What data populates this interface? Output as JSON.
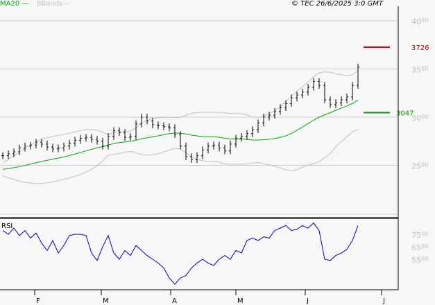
{
  "legend": {
    "ma": "MA20",
    "bbands": "BBands"
  },
  "copyright": "© TEC 26/6/2025 3:0 GMT",
  "colors": {
    "ma": "#00aa00",
    "bands": "#c0c0c0",
    "price": "#000000",
    "rsi": "#0000cc",
    "resistance": "#cc0000",
    "support": "#009900",
    "grid": "#cccccc",
    "axisText": "#c0c0c0"
  },
  "chart_data": [
    {
      "type": "line",
      "title": "Price (OHLC bars) with MA20 and Bollinger Bands",
      "ylim": [
        21,
        42.5
      ],
      "yticks": [
        {
          "value": 40,
          "label": "40",
          "sup": "00"
        },
        {
          "value": 35,
          "label": "35",
          "sup": "00"
        },
        {
          "value": 30,
          "label": "30",
          "sup": "00"
        },
        {
          "value": 25,
          "label": "25",
          "sup": "00"
        }
      ],
      "closes": [
        26.0,
        26.2,
        26.4,
        26.8,
        27.0,
        27.1,
        27.4,
        27.2,
        26.9,
        26.7,
        26.8,
        27.0,
        27.3,
        27.6,
        27.8,
        27.9,
        27.7,
        27.5,
        27.0,
        28.0,
        28.6,
        28.4,
        27.9,
        28.0,
        29.3,
        30.0,
        29.6,
        29.2,
        29.1,
        29.0,
        28.9,
        28.2,
        27.0,
        25.9,
        25.6,
        26.0,
        26.6,
        27.0,
        27.1,
        26.8,
        26.5,
        27.2,
        27.8,
        28.0,
        28.3,
        28.7,
        29.4,
        30.0,
        30.2,
        30.6,
        31.0,
        31.4,
        32.0,
        32.3,
        32.6,
        33.1,
        33.7,
        33.3,
        31.8,
        31.3,
        31.5,
        31.8,
        32.1,
        33.3,
        35.2
      ],
      "levels": [
        {
          "value": 37.26,
          "label": "3726",
          "kind": "resistance"
        },
        {
          "value": 30.47,
          "label": "3047",
          "kind": "support"
        }
      ],
      "xticks": [
        "F",
        "M",
        "A",
        "M",
        "J",
        "J"
      ]
    },
    {
      "type": "line",
      "title": "RSI",
      "label": "RSI",
      "ylim": [
        30,
        86
      ],
      "yticks": [
        {
          "value": 75,
          "label": "75",
          "sup": "00"
        },
        {
          "value": 65,
          "label": "65",
          "sup": "00"
        },
        {
          "value": 55,
          "label": "55",
          "sup": "00"
        }
      ],
      "values": [
        78,
        75,
        80,
        74,
        78,
        72,
        76,
        68,
        62,
        70,
        60,
        66,
        74,
        75,
        75,
        74,
        60,
        54,
        65,
        74,
        60,
        55,
        62,
        58,
        66,
        62,
        58,
        55,
        52,
        48,
        40,
        35,
        40,
        42,
        48,
        52,
        55,
        52,
        50,
        55,
        58,
        55,
        62,
        60,
        70,
        72,
        70,
        73,
        72,
        78,
        80,
        82,
        78,
        79,
        82,
        80,
        84,
        78,
        55,
        54,
        58,
        60,
        63,
        70,
        82
      ]
    }
  ]
}
